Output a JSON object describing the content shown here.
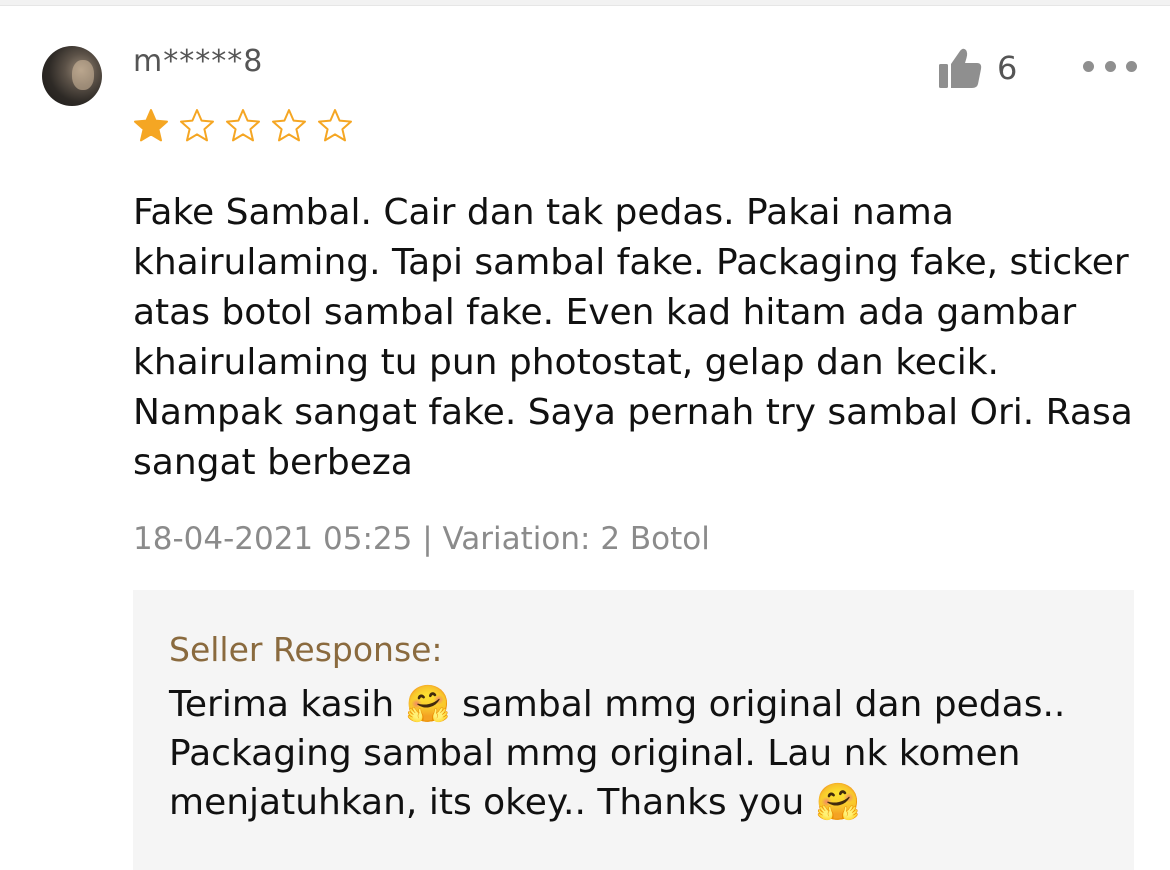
{
  "review": {
    "username": "m*****8",
    "likes": "6",
    "rating": 1,
    "rating_max": 5,
    "text": "Fake Sambal. Cair dan tak pedas. Pakai nama khairulaming. Tapi sambal fake. Packaging fake, sticker atas botol sambal fake. Even kad hitam ada gambar khairulaming tu pun photostat, gelap dan kecik. Nampak sangat fake. Saya pernah try sambal Ori. Rasa sangat berbeza",
    "meta": "18-04-2021 05:25 | Variation: 2 Botol"
  },
  "seller_response": {
    "label": "Seller Response:",
    "text": "Terima kasih 🤗 sambal mmg original dan pedas.. Packaging sambal mmg original. Lau nk komen menjatuhkan, its okey.. Thanks you 🤗"
  },
  "icons": {
    "like": "thumbs-up-icon",
    "more": "more-dots-icon",
    "star_filled": "star-filled-icon",
    "star_empty": "star-outline-icon"
  },
  "colors": {
    "star": "#f5a623",
    "seller_label": "#8a6a3e",
    "meta": "#8b8b8b"
  }
}
